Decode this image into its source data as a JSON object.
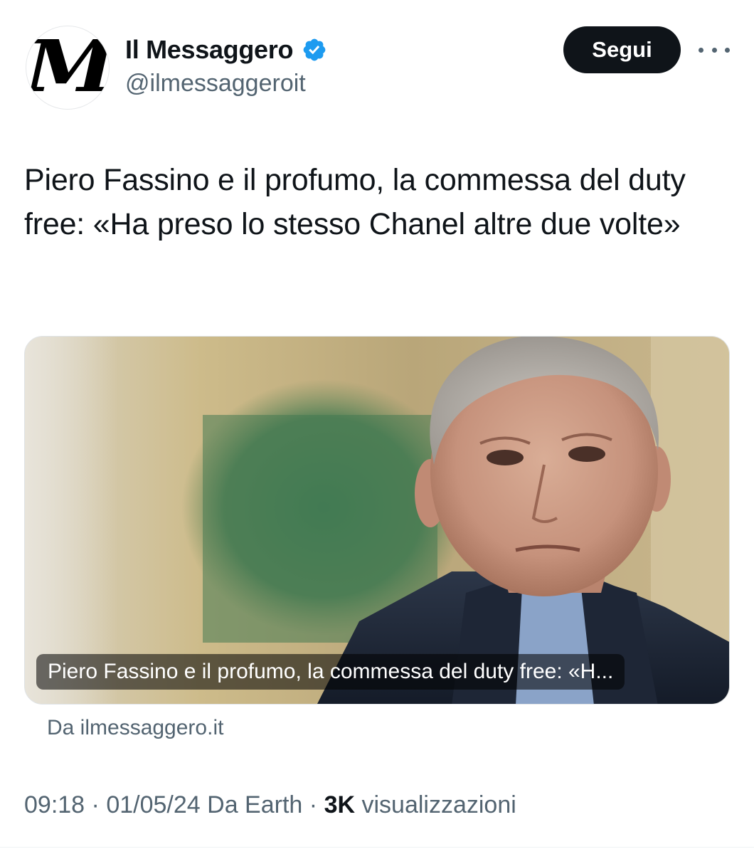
{
  "account": {
    "display_name": "Il Messaggero",
    "handle": "@ilmessaggeroit",
    "avatar_letter": "M",
    "verified": true,
    "verified_color": "#1d9bf0"
  },
  "actions": {
    "follow_label": "Segui",
    "more_icon": "more-horizontal-icon"
  },
  "tweet": {
    "text": "Piero Fassino e il profumo, la commessa del duty free: «Ha preso lo stesso Chanel altre due volte»"
  },
  "card": {
    "caption": "Piero Fassino e il profumo, la commessa del duty free: «H...",
    "source": "Da ilmessaggero.it"
  },
  "meta": {
    "time": "09:18",
    "separator": "·",
    "date": "01/05/24",
    "client": "Da Earth",
    "views_count": "3K",
    "views_label": "visualizzazioni"
  }
}
